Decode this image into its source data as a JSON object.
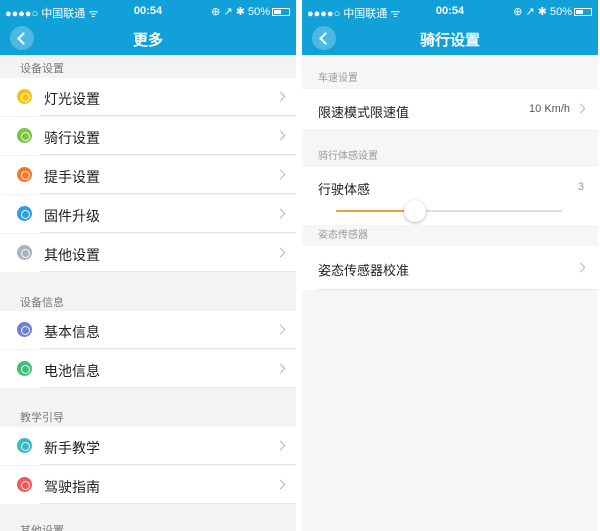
{
  "status_bar": {
    "carrier": "●●●●○ 中国联通 ᯤ",
    "time": "00:54",
    "right": "⊕ ↗ ✱ 50%"
  },
  "left_screen": {
    "title": "更多",
    "sections": [
      {
        "label": "设备设置",
        "items": [
          {
            "label": "灯光设置",
            "icon": "lightbulb-icon",
            "color": "#f2c418"
          },
          {
            "label": "骑行设置",
            "icon": "ride-icon",
            "color": "#7cc342"
          },
          {
            "label": "提手设置",
            "icon": "handle-icon",
            "color": "#f07a2a"
          },
          {
            "label": "固件升级",
            "icon": "upgrade-icon",
            "color": "#2d9ee8"
          },
          {
            "label": "其他设置",
            "icon": "settings-icon",
            "color": "#a8b3bd"
          }
        ]
      },
      {
        "label": "设备信息",
        "items": [
          {
            "label": "基本信息",
            "icon": "info-icon",
            "color": "#6e7fd6"
          },
          {
            "label": "电池信息",
            "icon": "battery-icon",
            "color": "#3fc07a"
          }
        ]
      },
      {
        "label": "教学引导",
        "items": [
          {
            "label": "新手教学",
            "icon": "book-icon",
            "color": "#39b8c9"
          },
          {
            "label": "驾驶指南",
            "icon": "guide-icon",
            "color": "#ee5a5a"
          }
        ]
      }
    ],
    "clipped_section_label": "其他设置"
  },
  "right_screen": {
    "title": "骑行设置",
    "speed_section_label": "车速设置",
    "speed_limit_label": "限速模式限速值",
    "speed_limit_value": "10 Km/h",
    "feel_section_label": "骑行体感设置",
    "feel_label": "行驶体感",
    "feel_value": "3",
    "feel_level_fraction": 0.35,
    "sensor_section_label": "姿态传感器",
    "sensor_calibration_label": "姿态传感器校准",
    "accent_color": "#f39a3a"
  }
}
